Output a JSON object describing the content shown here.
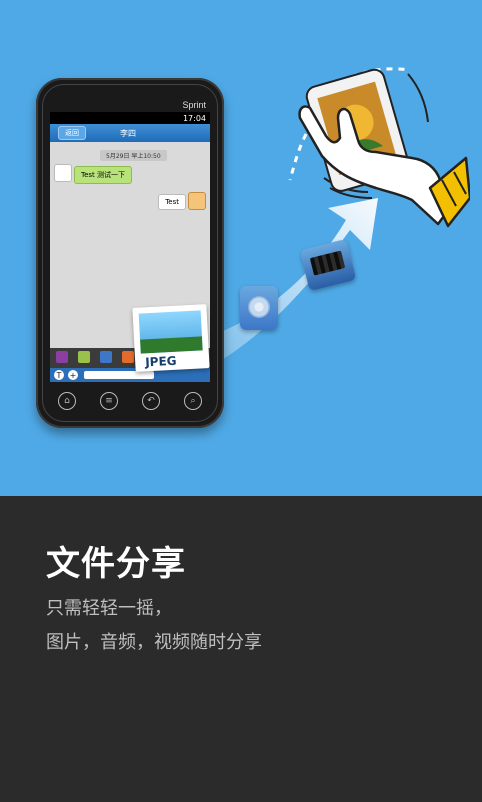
{
  "hero": {
    "carrier": "Sprint",
    "status_time": "17:04",
    "chat": {
      "back_label": "返回",
      "contact_name": "李四",
      "date_stamp": "5月29日  早上10:50",
      "incoming_message": "Test 测试一下",
      "outgoing_message": "Test"
    },
    "file_badge": "JPEG"
  },
  "content": {
    "title": "文件分享",
    "line1": "只需轻轻一摇，",
    "line2": "图片，音频，视频随时分享"
  }
}
